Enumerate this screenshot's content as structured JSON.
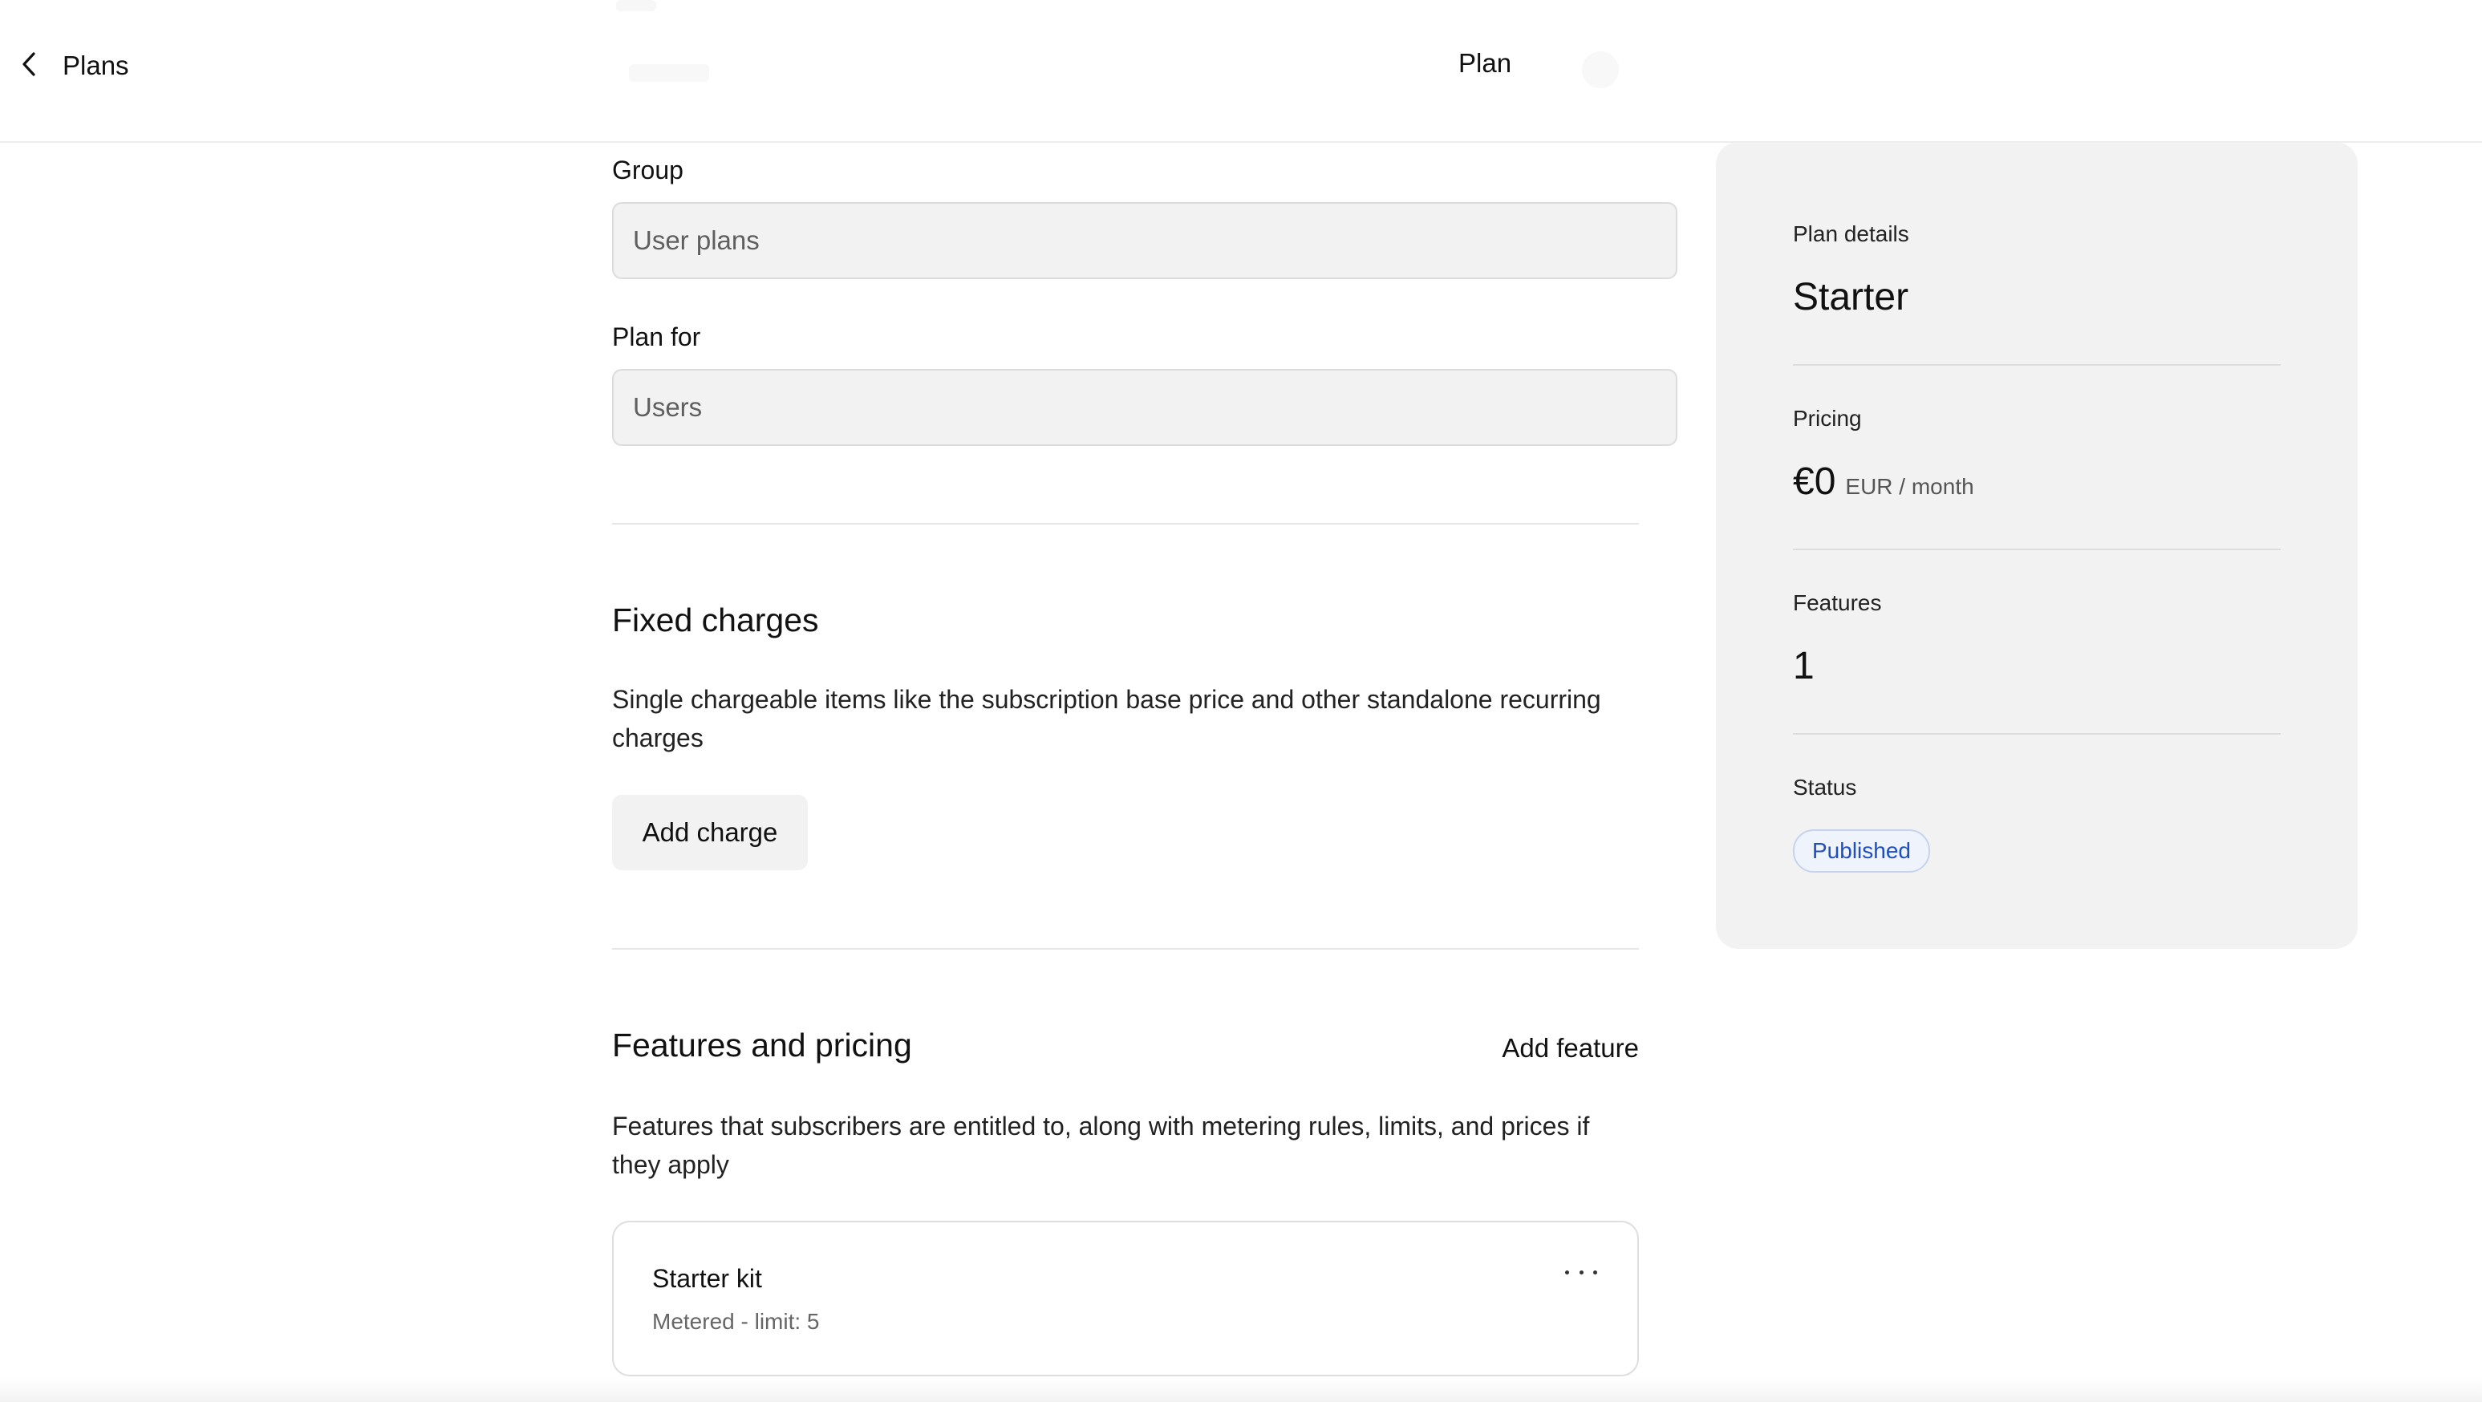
{
  "header": {
    "back_label": "Plans",
    "title": "Plan"
  },
  "form": {
    "group": {
      "label": "Group",
      "value": "User plans"
    },
    "plan_for": {
      "label": "Plan for",
      "value": "Users"
    }
  },
  "fixed_charges": {
    "title": "Fixed charges",
    "description": "Single chargeable items like the subscription base price and other standalone recurring charges",
    "add_button": "Add charge"
  },
  "features": {
    "title": "Features and pricing",
    "add_button": "Add feature",
    "description": "Features that subscribers are entitled to, along with metering rules, limits, and prices if they apply",
    "items": [
      {
        "name": "Starter kit",
        "meta": "Metered - limit: 5"
      }
    ]
  },
  "plan_details": {
    "label": "Plan details",
    "name": "Starter",
    "pricing_label": "Pricing",
    "price_amount": "€0",
    "price_unit": "EUR / month",
    "features_label": "Features",
    "features_count": "1",
    "status_label": "Status",
    "status": "Published"
  },
  "colors": {
    "status_badge_text": "#1f4fbf",
    "status_badge_bg": "#eef3fc",
    "panel_bg": "#f2f2f2"
  },
  "icons": {
    "back": "chevron-left-icon",
    "more": "more-horizontal-icon"
  }
}
